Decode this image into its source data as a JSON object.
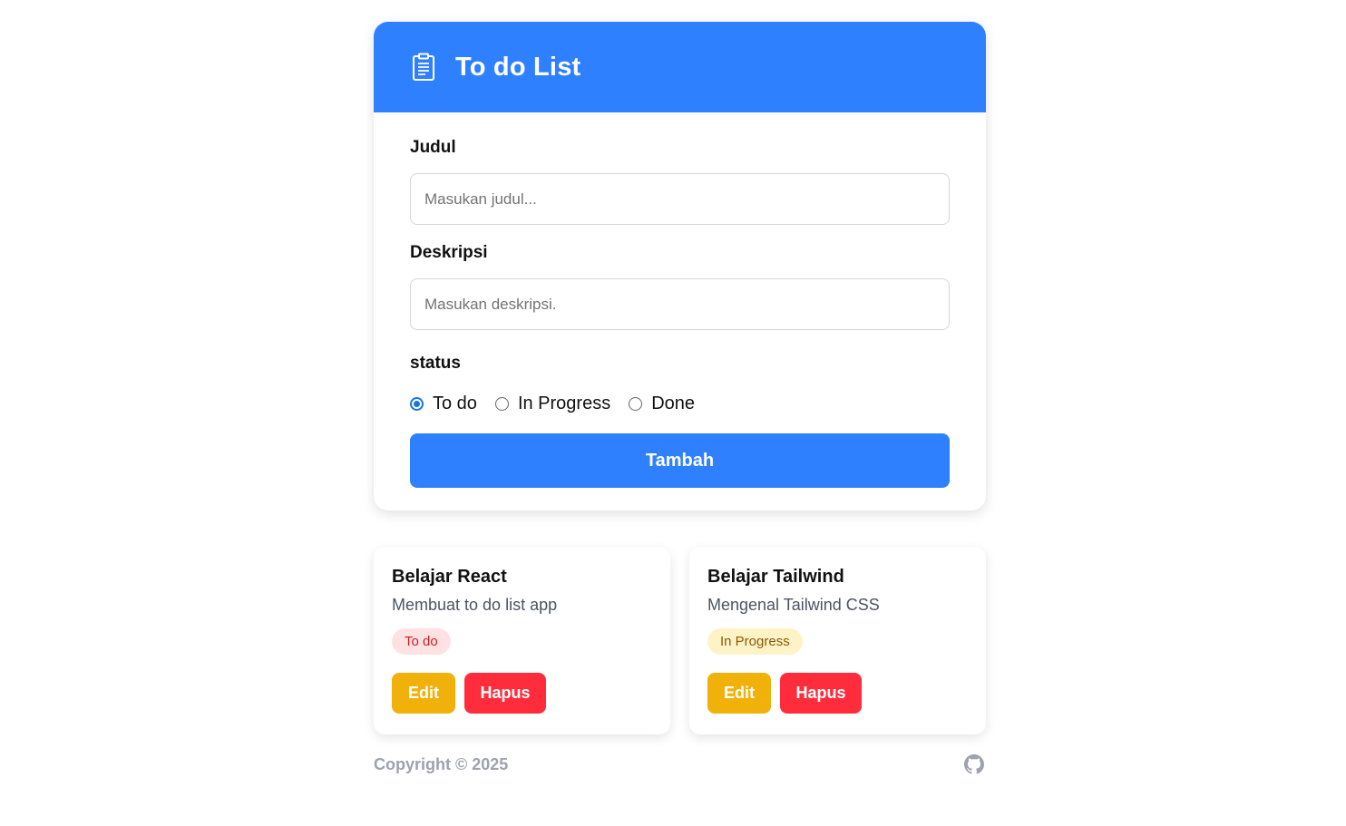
{
  "header": {
    "title": "To do List",
    "icon": "clipboard-icon"
  },
  "form": {
    "title_label": "Judul",
    "title_placeholder": "Masukan judul...",
    "title_value": "",
    "desc_label": "Deskripsi",
    "desc_placeholder": "Masukan deskripsi.",
    "desc_value": "",
    "status_label": "status",
    "status_options": [
      {
        "label": "To do",
        "selected": true
      },
      {
        "label": "In Progress",
        "selected": false
      },
      {
        "label": "Done",
        "selected": false
      }
    ],
    "submit_label": "Tambah"
  },
  "tasks": [
    {
      "title": "Belajar React",
      "description": "Membuat to do list app",
      "status": "To do",
      "edit_label": "Edit",
      "delete_label": "Hapus"
    },
    {
      "title": "Belajar Tailwind",
      "description": "Mengenal Tailwind CSS",
      "status": "In Progress",
      "edit_label": "Edit",
      "delete_label": "Hapus"
    }
  ],
  "footer": {
    "copyright": "Copyright © 2025",
    "icon": "github-icon"
  },
  "colors": {
    "primary": "#2f80ff",
    "edit": "#f0b10a",
    "delete": "#ff2d3c",
    "badge_todo_bg": "#fee2e2",
    "badge_progress_bg": "#fef3c7"
  }
}
